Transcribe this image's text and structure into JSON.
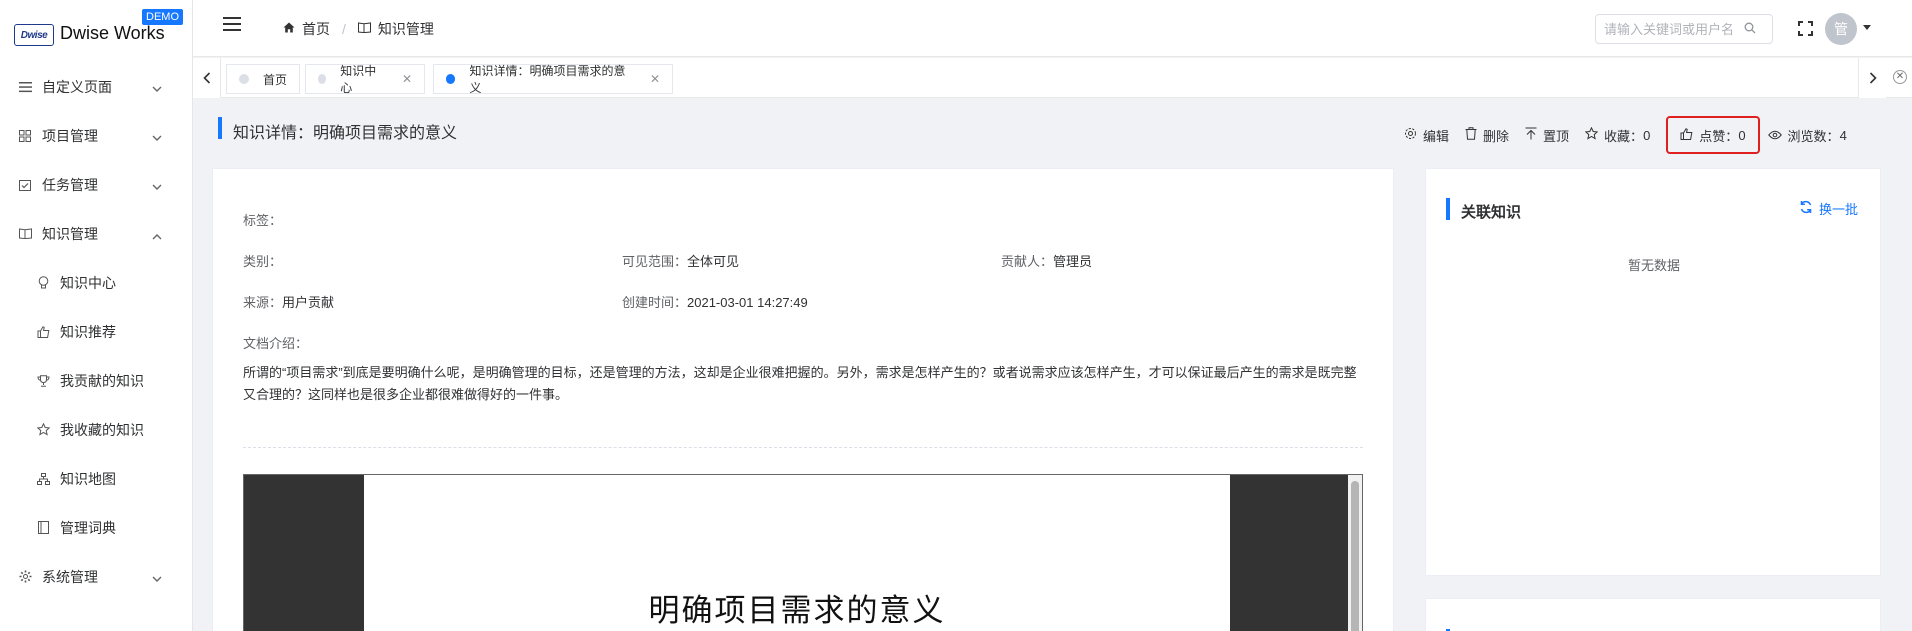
{
  "logo": {
    "text": "Dwise Works",
    "mark": "Dwise",
    "badge": "DEMO"
  },
  "sidebar": {
    "items": [
      {
        "label": "自定义页面",
        "icon": "list-icon",
        "expanded": false
      },
      {
        "label": "项目管理",
        "icon": "grid-icon",
        "expanded": false
      },
      {
        "label": "任务管理",
        "icon": "checkbox-icon",
        "expanded": false
      },
      {
        "label": "知识管理",
        "icon": "book-icon",
        "expanded": true
      },
      {
        "label": "系统管理",
        "icon": "gear-icon",
        "expanded": false
      }
    ],
    "knowledge_sub": [
      {
        "label": "知识中心",
        "icon": "lightbulb-icon"
      },
      {
        "label": "知识推荐",
        "icon": "thumbs-up-icon"
      },
      {
        "label": "我贡献的知识",
        "icon": "trophy-icon"
      },
      {
        "label": "我收藏的知识",
        "icon": "star-icon"
      },
      {
        "label": "知识地图",
        "icon": "sitemap-icon"
      },
      {
        "label": "管理词典",
        "icon": "book-icon"
      }
    ]
  },
  "header": {
    "breadcrumb": [
      {
        "label": "首页",
        "icon": "home-icon"
      },
      {
        "label": "知识管理",
        "icon": "book-icon"
      }
    ],
    "search_placeholder": "请输入关键词或用户名",
    "avatar_text": "管"
  },
  "tabs": [
    {
      "label": "首页",
      "closable": false,
      "active": false
    },
    {
      "label": "知识中心",
      "closable": true,
      "active": false
    },
    {
      "label": "知识详情：明确项目需求的意义",
      "closable": true,
      "active": true
    }
  ],
  "page": {
    "title": "知识详情：明确项目需求的意义",
    "actions": {
      "edit": "编辑",
      "delete": "删除",
      "pin": "置顶",
      "favorite_label": "收藏：",
      "favorite_count": "0",
      "like_label": "点赞：",
      "like_count": "0",
      "views_label": "浏览数：",
      "views_count": "4"
    }
  },
  "detail": {
    "tags_label": "标签：",
    "tags_value": "",
    "category_label": "类别：",
    "category_value": "",
    "visibility_label": "可见范围：",
    "visibility_value": "全体可见",
    "contributor_label": "贡献人：",
    "contributor_value": "管理员",
    "source_label": "来源：",
    "source_value": "用户贡献",
    "created_label": "创建时间：",
    "created_value": "2021-03-01 14:27:49",
    "intro_label": "文档介绍：",
    "intro_text": "所谓的“项目需求”到底是要明确什么呢，是明确管理的目标，还是管理的方法，这却是企业很难把握的。另外，需求是怎样产生的？或者说需求应该怎样产生，才可以保证最后产生的需求是既完整又合理的？这同样也是很多企业都很难做得好的一件事。",
    "doc_title": "明确项目需求的意义"
  },
  "related": {
    "title": "关联知识",
    "refresh": "换一批",
    "empty": "暂无数据"
  }
}
